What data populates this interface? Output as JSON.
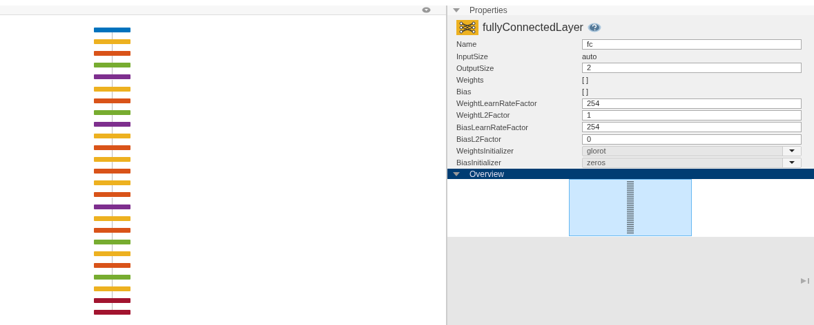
{
  "canvas": {
    "layers": [
      {
        "color": "#0072bd"
      },
      {
        "color": "#edb120"
      },
      {
        "color": "#d95319"
      },
      {
        "color": "#77ac30"
      },
      {
        "color": "#7e2f8e"
      },
      {
        "color": "#edb120"
      },
      {
        "color": "#d95319"
      },
      {
        "color": "#77ac30"
      },
      {
        "color": "#7e2f8e"
      },
      {
        "color": "#edb120"
      },
      {
        "color": "#d95319"
      },
      {
        "color": "#edb120"
      },
      {
        "color": "#d95319"
      },
      {
        "color": "#edb120"
      },
      {
        "color": "#d95319"
      },
      {
        "color": "#7e2f8e"
      },
      {
        "color": "#edb120"
      },
      {
        "color": "#d95319"
      },
      {
        "color": "#77ac30"
      },
      {
        "color": "#edb120"
      },
      {
        "color": "#d95319"
      },
      {
        "color": "#77ac30"
      },
      {
        "color": "#edb120"
      },
      {
        "color": "#a2142f"
      },
      {
        "color": "#a2142f"
      }
    ]
  },
  "properties": {
    "title": "Properties",
    "expanded": true,
    "layer_title": "fullyConnectedLayer",
    "fields": [
      {
        "label": "Name",
        "kind": "input",
        "value": "fc"
      },
      {
        "label": "InputSize",
        "kind": "text",
        "value": "auto"
      },
      {
        "label": "OutputSize",
        "kind": "input",
        "value": "2"
      },
      {
        "label": "Weights",
        "kind": "text",
        "value": "[ ]"
      },
      {
        "label": "Bias",
        "kind": "text",
        "value": "[ ]"
      },
      {
        "label": "WeightLearnRateFactor",
        "kind": "input",
        "value": "254"
      },
      {
        "label": "WeightL2Factor",
        "kind": "input",
        "value": "1"
      },
      {
        "label": "BiasLearnRateFactor",
        "kind": "input",
        "value": "254"
      },
      {
        "label": "BiasL2Factor",
        "kind": "input",
        "value": "0"
      },
      {
        "label": "WeightsInitializer",
        "kind": "dropdown",
        "value": "glorot"
      },
      {
        "label": "BiasInitializer",
        "kind": "dropdown",
        "value": "zeros"
      }
    ]
  },
  "overview": {
    "title": "Overview",
    "expanded": true
  }
}
